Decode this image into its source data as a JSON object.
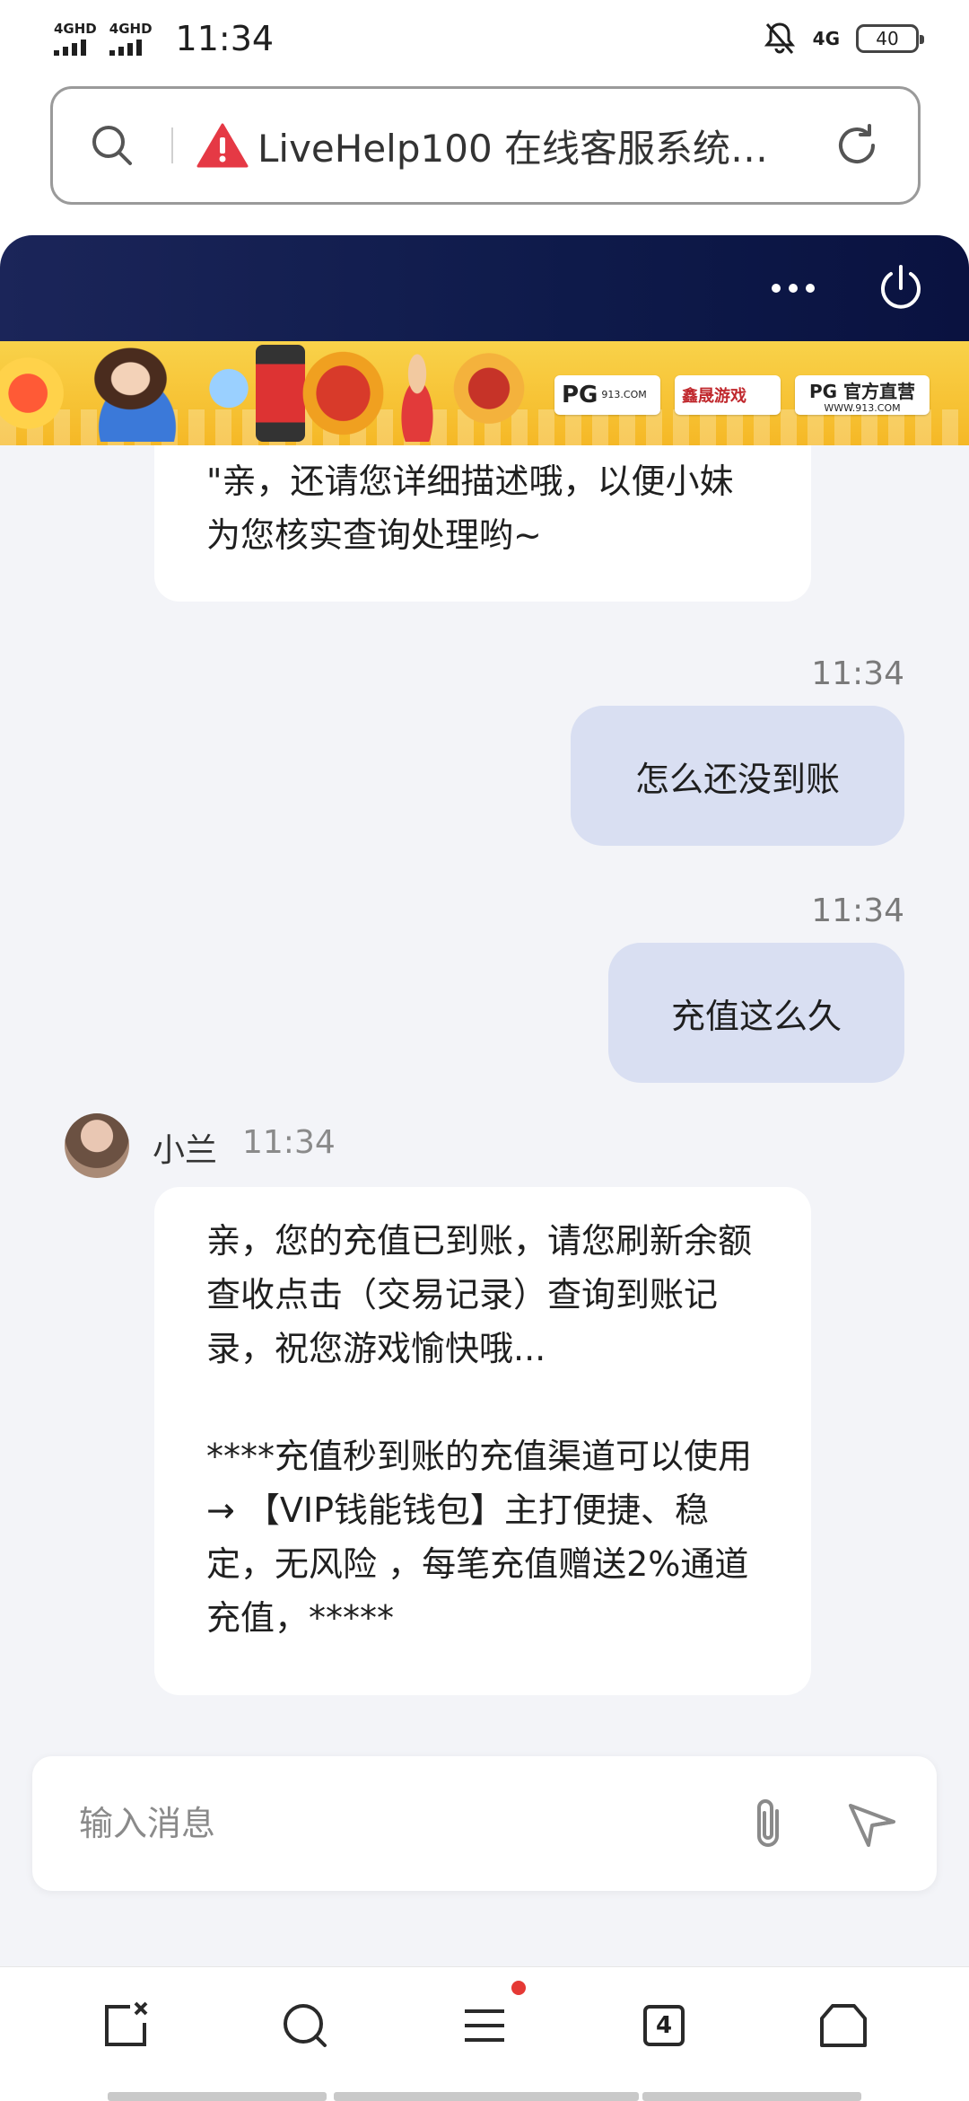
{
  "status_bar": {
    "sim1": "4GHD",
    "sim2": "4GHD",
    "time": "11:34",
    "network": "4G",
    "battery": "40"
  },
  "address_bar": {
    "title": "LiveHelp100 在线客服系统…"
  },
  "banner": {
    "logo1_text": "PG",
    "logo1_small": "913.COM",
    "logo2_text": "鑫晟游戏",
    "logo3_text": "PG 官方直营",
    "logo3_small": "WWW.913.COM"
  },
  "messages": [
    {
      "side": "left",
      "text": "\"亲，还请您详细描述哦，以便小妹为您核实查询处理哟~"
    },
    {
      "side": "right",
      "time": "11:34",
      "text": "怎么还没到账"
    },
    {
      "side": "right",
      "time": "11:34",
      "text": "充值这么久"
    },
    {
      "side": "left",
      "sender": "小兰",
      "time": "11:34",
      "text": "亲，您的充值已到账，请您刷新余额查收点击（交易记录）查询到账记录，祝您游戏愉快哦...\n\n****充值秒到账的充值渠道可以使用→ 【VIP钱能钱包】主打便捷、稳定，无风险 ，每笔充值赠送2%通道充值，*****"
    }
  ],
  "input": {
    "placeholder": "输入消息"
  },
  "bottom_nav": {
    "tabs_count": "4"
  },
  "colors": {
    "header": "#0e1a4a",
    "user_bubble": "#d9dff2",
    "chat_bg": "#f3f4f8",
    "warning": "#e53945",
    "notification_dot": "#e53935"
  }
}
